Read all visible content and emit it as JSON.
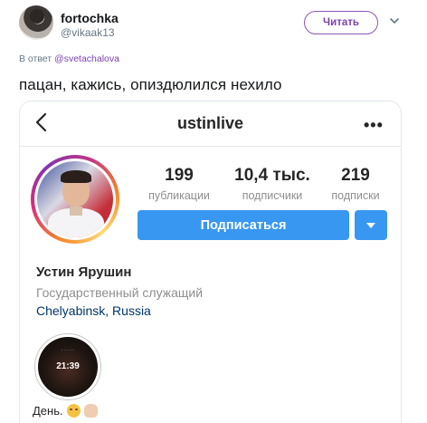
{
  "tweet": {
    "display_name": "fortochka",
    "handle": "@vikaak13",
    "follow_label": "Читать",
    "reply_prefix": "В ответ",
    "reply_mention": "@svetachalova",
    "text": "пацан, кажись, опиздюлился нехило"
  },
  "instagram": {
    "username": "ustinlive",
    "menu_icon": "more-dots-icon",
    "back_icon": "chevron-left-icon",
    "stats": [
      {
        "value": "199",
        "label": "публикации"
      },
      {
        "value": "10,4 тыс.",
        "label": "подписчики"
      },
      {
        "value": "219",
        "label": "подписки"
      }
    ],
    "subscribe_label": "Подписаться",
    "full_name": "Устин Ярушин",
    "category": "Государственный служащий",
    "location": "Chelyabinsk, Russia",
    "highlight": {
      "time": "21:39",
      "label": "День."
    }
  },
  "colors": {
    "accent_purple": "#7b3fb0",
    "ig_blue": "#3897f0",
    "ig_link": "#003569",
    "muted": "#8e8e8e"
  }
}
